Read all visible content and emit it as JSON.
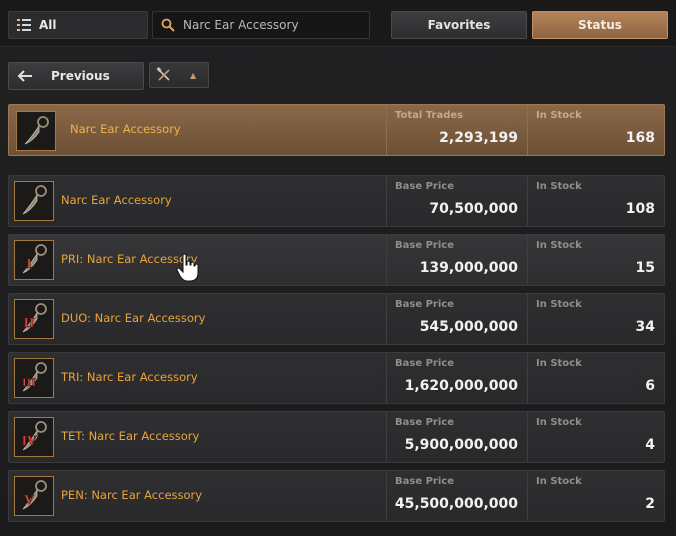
{
  "topbar": {
    "category_label": "All",
    "search_value": "Narc Ear Accessory",
    "favorites_label": "Favorites",
    "status_label": "Status"
  },
  "nav": {
    "previous_label": "Previous"
  },
  "summary": {
    "name": "Narc Ear Accessory",
    "total_trades_label": "Total Trades",
    "total_trades": "2,293,199",
    "in_stock_label": "In Stock",
    "in_stock": "168"
  },
  "items": [
    {
      "name": "Narc Ear Accessory",
      "enh": "",
      "price_label": "Base Price",
      "price": "70,500,000",
      "stock_label": "In Stock",
      "stock": "108"
    },
    {
      "name": "PRI: Narc Ear Accessory",
      "enh": "I",
      "price_label": "Base Price",
      "price": "139,000,000",
      "stock_label": "In Stock",
      "stock": "15"
    },
    {
      "name": "DUO: Narc Ear Accessory",
      "enh": "II",
      "price_label": "Base Price",
      "price": "545,000,000",
      "stock_label": "In Stock",
      "stock": "34"
    },
    {
      "name": "TRI: Narc Ear Accessory",
      "enh": "III",
      "price_label": "Base Price",
      "price": "1,620,000,000",
      "stock_label": "In Stock",
      "stock": "6"
    },
    {
      "name": "TET: Narc Ear Accessory",
      "enh": "IV",
      "price_label": "Base Price",
      "price": "5,900,000,000",
      "stock_label": "In Stock",
      "stock": "4"
    },
    {
      "name": "PEN: Narc Ear Accessory",
      "enh": "V",
      "price_label": "Base Price",
      "price": "45,500,000,000",
      "stock_label": "In Stock",
      "stock": "2"
    }
  ],
  "icons": {
    "category": "list-icon",
    "search": "search-icon",
    "previous": "arrow-left-icon",
    "filter": "crossed-tools-icon",
    "sort": "caret-up-icon",
    "item": "earring-icon",
    "pointer": "hand-cursor-icon"
  },
  "colors": {
    "accent": "#b58358",
    "item_name": "#e7a53a",
    "enhancement": "#d9473a"
  }
}
